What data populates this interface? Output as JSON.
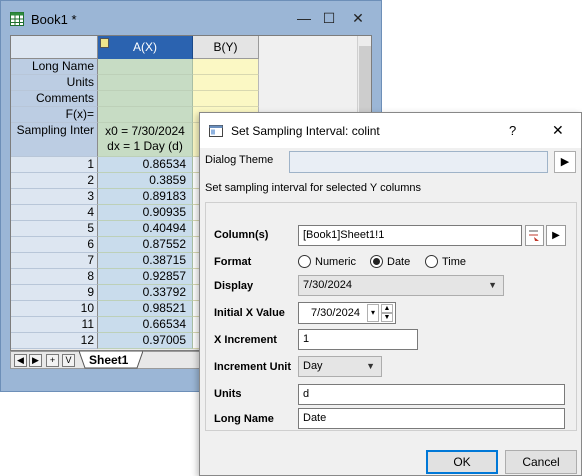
{
  "book": {
    "title": "Book1 *",
    "minimize": "—",
    "maximize": "☐",
    "close": "✕",
    "columns": [
      {
        "label": "A(X)",
        "selected": true
      },
      {
        "label": "B(Y)",
        "selected": false
      }
    ],
    "row_headers": [
      "Long Name",
      "Units",
      "Comments",
      "F(x)=",
      "Sampling Inter"
    ],
    "sampling_line1": "x0 = 7/30/2024",
    "sampling_line2": "dx = 1 Day (d)",
    "rows": [
      {
        "n": "1",
        "a": "0.86534"
      },
      {
        "n": "2",
        "a": "0.3859"
      },
      {
        "n": "3",
        "a": "0.89183"
      },
      {
        "n": "4",
        "a": "0.90935"
      },
      {
        "n": "5",
        "a": "0.40494"
      },
      {
        "n": "6",
        "a": "0.87552"
      },
      {
        "n": "7",
        "a": "0.38715"
      },
      {
        "n": "8",
        "a": "0.92857"
      },
      {
        "n": "9",
        "a": "0.33792"
      },
      {
        "n": "10",
        "a": "0.98521"
      },
      {
        "n": "11",
        "a": "0.66534"
      },
      {
        "n": "12",
        "a": "0.97005"
      }
    ],
    "tabs": {
      "nav": [
        "◀",
        "▶",
        "+",
        "V"
      ],
      "sheet": "Sheet1"
    }
  },
  "dialog": {
    "title": "Set Sampling Interval: colint",
    "help": "?",
    "close": "✕",
    "theme_label": "Dialog Theme",
    "theme_value": "",
    "theme_button": "▶",
    "description": "Set sampling interval for selected Y columns",
    "columns_label": "Column(s)",
    "columns_value": "[Book1]Sheet1!1",
    "format_label": "Format",
    "format_options": [
      "Numeric",
      "Date",
      "Time"
    ],
    "format_selected": "Date",
    "display_label": "Display",
    "display_value": "7/30/2024",
    "initial_label": "Initial X Value",
    "initial_value": "7/30/2024",
    "increment_label": "X Increment",
    "increment_value": "1",
    "unit_label": "Increment Unit",
    "unit_value": "Day",
    "units_label": "Units",
    "units_value": "d",
    "longname_label": "Long Name",
    "longname_value": "Date",
    "ok": "OK",
    "cancel": "Cancel"
  },
  "colors": {
    "book_frame": "#9bb6d6",
    "col_selected": "#2b63b0",
    "col_a_cells": "#c7dcc4",
    "col_b_cells": "#fbf8c4",
    "dialog_bg": "#f0f0f0",
    "ok_border": "#0078d7"
  }
}
